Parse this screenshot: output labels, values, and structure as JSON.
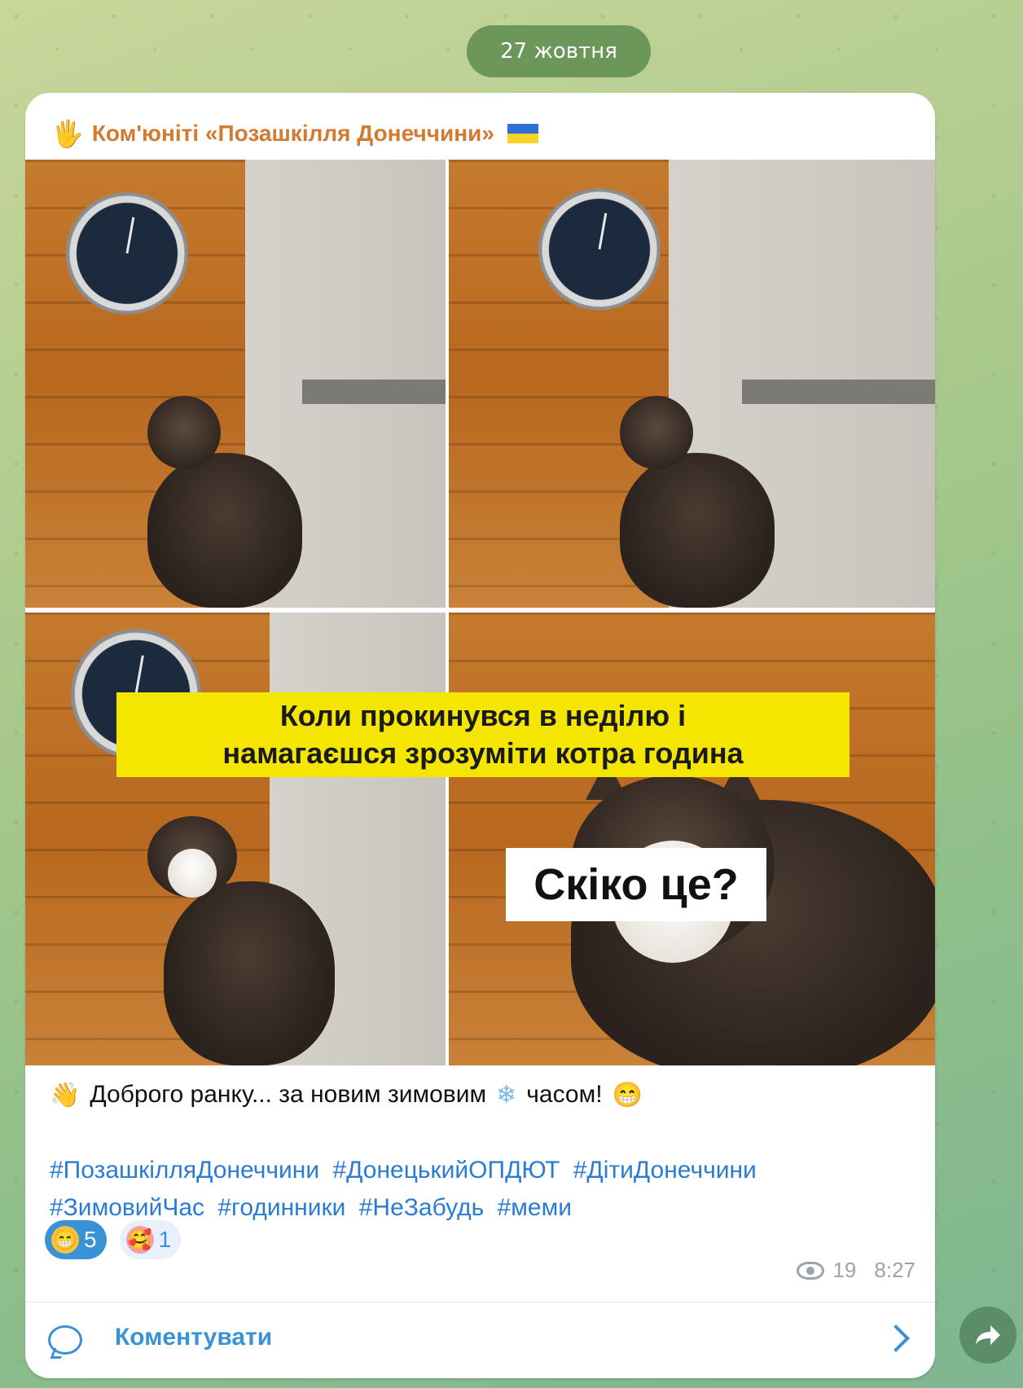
{
  "chat": {
    "date_label": "27 жовтня"
  },
  "message": {
    "sender": "Ком'юніті «Позашкілля Донеччини»",
    "meme": {
      "caption_line1": "Коли прокинувся в неділю і",
      "caption_line2": "намагаєшся зрозуміти котра година",
      "question": "Скіко це?"
    },
    "text": {
      "greeting_before": "Доброго ранку... за новим зимовим",
      "greeting_after": "часом!",
      "hashtags": [
        "#ПозашкілляДонеччини",
        "#ДонецькийОПДЮТ",
        "#ДітиДонеччини",
        "#ЗимовийЧас",
        "#годинники",
        "#НеЗабудь",
        "#меми"
      ]
    },
    "reactions": [
      {
        "emoji": "grinning-face",
        "count": "5",
        "active": true
      },
      {
        "emoji": "smiling-face-with-hearts",
        "count": "1",
        "active": false
      }
    ],
    "views": "19",
    "time": "8:27",
    "comment_label": "Коментувати"
  },
  "colors": {
    "sender": "#d27a2f",
    "link": "#2a7bd4",
    "accent": "#3a92d6",
    "caption_band": "#f4e600"
  }
}
